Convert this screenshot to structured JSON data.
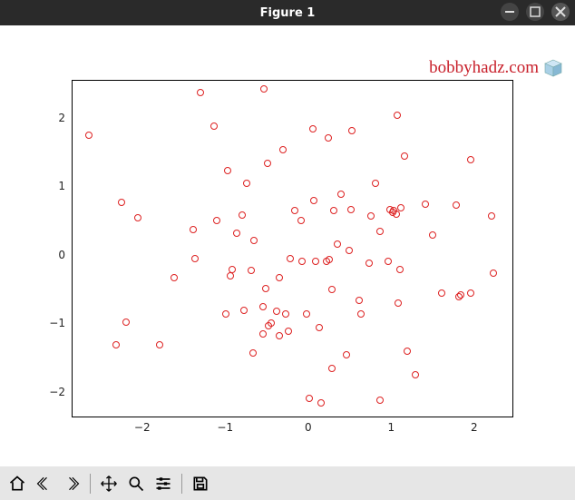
{
  "window": {
    "title": "Figure 1",
    "controls": {
      "minimize": "–",
      "maximize": "□",
      "close": "×"
    }
  },
  "watermark": {
    "text": "bobbyhadz.com"
  },
  "toolbar": {
    "home": "Home",
    "back": "Back",
    "forward": "Forward",
    "pan": "Pan",
    "zoom": "Zoom",
    "configure": "Configure subplots",
    "save": "Save"
  },
  "chart_data": {
    "type": "scatter",
    "title": "",
    "xlabel": "",
    "ylabel": "",
    "xlim": [
      -2.85,
      2.45
    ],
    "ylim": [
      -2.35,
      2.55
    ],
    "xticks": [
      -2,
      -1,
      0,
      1,
      2
    ],
    "yticks": [
      -2,
      -1,
      0,
      1,
      2
    ],
    "series": [
      {
        "name": "points",
        "color": "#d22",
        "marker": "o_open",
        "points": [
          [
            -2.65,
            1.75
          ],
          [
            -2.33,
            -1.31
          ],
          [
            -2.26,
            0.78
          ],
          [
            -2.21,
            -0.97
          ],
          [
            -2.06,
            0.55
          ],
          [
            -1.8,
            -1.3
          ],
          [
            -1.63,
            -0.32
          ],
          [
            -1.4,
            0.38
          ],
          [
            -1.38,
            -0.04
          ],
          [
            -1.31,
            2.38
          ],
          [
            -1.15,
            1.89
          ],
          [
            -1.11,
            0.51
          ],
          [
            -1.0,
            -0.85
          ],
          [
            -0.98,
            1.24
          ],
          [
            -0.95,
            -0.3
          ],
          [
            -0.93,
            -0.2
          ],
          [
            -0.87,
            0.33
          ],
          [
            -0.81,
            0.59
          ],
          [
            -0.78,
            -0.8
          ],
          [
            -0.75,
            1.05
          ],
          [
            -0.7,
            -0.22
          ],
          [
            -0.67,
            -1.42
          ],
          [
            -0.66,
            0.22
          ],
          [
            -0.56,
            -1.14
          ],
          [
            -0.55,
            -0.75
          ],
          [
            -0.54,
            2.43
          ],
          [
            -0.52,
            -0.48
          ],
          [
            -0.5,
            1.35
          ],
          [
            -0.49,
            -1.03
          ],
          [
            -0.46,
            -0.98
          ],
          [
            -0.39,
            -0.82
          ],
          [
            -0.36,
            -0.32
          ],
          [
            -0.36,
            -1.17
          ],
          [
            -0.31,
            1.54
          ],
          [
            -0.28,
            -0.86
          ],
          [
            -0.25,
            -1.1
          ],
          [
            -0.23,
            -0.05
          ],
          [
            -0.17,
            0.66
          ],
          [
            -0.1,
            0.51
          ],
          [
            -0.08,
            -0.08
          ],
          [
            -0.03,
            -0.86
          ],
          [
            0.0,
            -2.09
          ],
          [
            0.05,
            1.85
          ],
          [
            0.06,
            0.8
          ],
          [
            0.08,
            -0.09
          ],
          [
            0.12,
            -1.05
          ],
          [
            0.14,
            -2.15
          ],
          [
            0.21,
            -0.09
          ],
          [
            0.23,
            1.71
          ],
          [
            0.24,
            -0.06
          ],
          [
            0.27,
            -1.65
          ],
          [
            0.28,
            -0.5
          ],
          [
            0.3,
            0.66
          ],
          [
            0.34,
            0.17
          ],
          [
            0.38,
            0.9
          ],
          [
            0.45,
            -1.45
          ],
          [
            0.48,
            0.07
          ],
          [
            0.5,
            0.67
          ],
          [
            0.52,
            1.82
          ],
          [
            0.6,
            -0.66
          ],
          [
            0.62,
            -0.85
          ],
          [
            0.72,
            -0.11
          ],
          [
            0.74,
            0.58
          ],
          [
            0.8,
            1.06
          ],
          [
            0.85,
            0.35
          ],
          [
            0.85,
            -2.11
          ],
          [
            0.95,
            -0.08
          ],
          [
            0.98,
            0.67
          ],
          [
            1.01,
            0.63
          ],
          [
            1.02,
            0.66
          ],
          [
            1.05,
            0.6
          ],
          [
            1.06,
            2.05
          ],
          [
            1.07,
            -0.7
          ],
          [
            1.1,
            -0.2
          ],
          [
            1.11,
            0.69
          ],
          [
            1.15,
            1.45
          ],
          [
            1.18,
            -1.4
          ],
          [
            1.28,
            -1.74
          ],
          [
            1.4,
            0.75
          ],
          [
            1.49,
            0.3
          ],
          [
            1.6,
            -0.55
          ],
          [
            1.77,
            0.73
          ],
          [
            1.8,
            -0.6
          ],
          [
            1.83,
            -0.58
          ],
          [
            1.95,
            1.4
          ],
          [
            1.95,
            -0.55
          ],
          [
            2.2,
            0.58
          ],
          [
            2.22,
            -0.26
          ]
        ]
      }
    ]
  }
}
